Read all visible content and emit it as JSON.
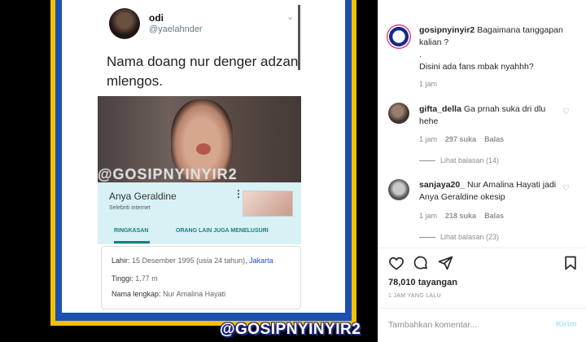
{
  "media": {
    "tweet": {
      "name": "odi",
      "handle": "@yaelahnder",
      "text": "Nama doang nur denger adzan mlengos."
    },
    "overlay_watermark": "@GOSIPNYINYIR2",
    "knowledge_panel": {
      "name": "Anya Geraldine",
      "kebab": "⋮",
      "subtitle": "Selebriti internet",
      "tab_overview": "RINGKASAN",
      "tab_others": "ORANG LAIN JUGA MENELUSURI"
    },
    "facts": {
      "birth_label": "Lahir:",
      "birth_value": "15 Desember 1995 (usia 24 tahun),",
      "birth_place": "Jakarta",
      "height_label": "Tinggi:",
      "height_value": "1,77 m",
      "fullname_label": "Nama lengkap:",
      "fullname_value": "Nur Amalina Hayati"
    },
    "bottom_watermark": "@GOSIPNYINYIR2"
  },
  "post": {
    "caption": {
      "user": "gosipnyinyir2",
      "line1": "Bagaimana tanggapan kalian ?",
      "line2": ".",
      "line3": "Disini ada fans mbak nyahhh?",
      "time": "1 jam"
    },
    "comments": [
      {
        "user": "gifta_della",
        "text": "Ga prnah suka dri dlu hehe",
        "time": "1 jam",
        "likes": "297 suka",
        "reply": "Balas",
        "view_replies": "Lihat balasan (14)"
      },
      {
        "user": "sanjaya20_",
        "text": "Nur Amalina Hayati jadi Anya Geraldine okesip",
        "time": "1 jam",
        "likes": "218 suka",
        "reply": "Balas",
        "view_replies": "Lihat balasan (23)"
      }
    ],
    "views": "78,010 tayangan",
    "posted_ago": "1 JAM YANG LALU",
    "comment_placeholder": "Tambahkan komentar...",
    "post_button": "Kirim"
  }
}
